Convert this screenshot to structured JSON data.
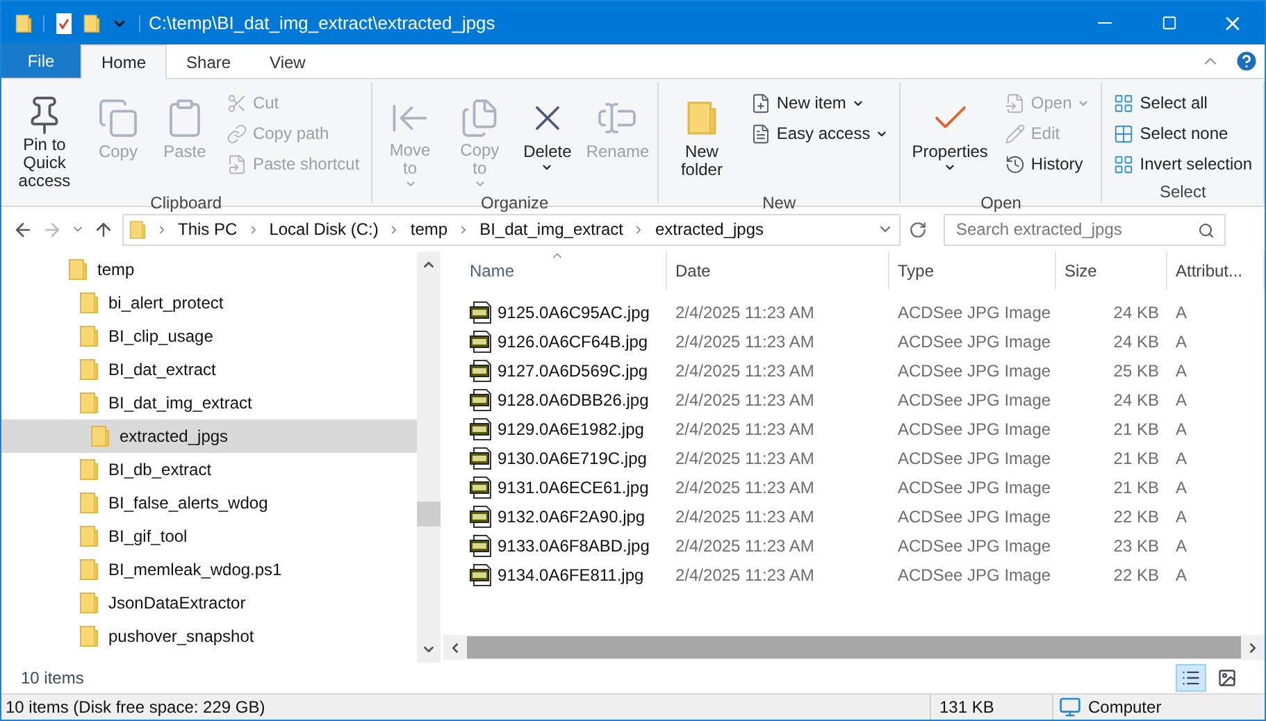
{
  "window": {
    "title": "C:\\temp\\BI_dat_img_extract\\extracted_jpgs"
  },
  "ribbon": {
    "tabs": [
      {
        "label": "File",
        "kind": "file",
        "selected": false
      },
      {
        "label": "Home",
        "kind": "tab",
        "selected": true
      },
      {
        "label": "Share",
        "kind": "tab",
        "selected": false
      },
      {
        "label": "View",
        "kind": "tab",
        "selected": false
      }
    ],
    "groups": [
      {
        "label": "Clipboard",
        "items": [
          {
            "label": "Pin to Quick access",
            "kind": "large",
            "disabled": false
          },
          {
            "label": "Copy",
            "kind": "large",
            "disabled": true
          },
          {
            "label": "Paste",
            "kind": "large",
            "disabled": true
          },
          {
            "kind": "stack",
            "items": [
              {
                "label": "Cut",
                "disabled": true
              },
              {
                "label": "Copy path",
                "disabled": true
              },
              {
                "label": "Paste shortcut",
                "disabled": true
              }
            ]
          }
        ]
      },
      {
        "label": "Organize",
        "items": [
          {
            "label": "Move to",
            "kind": "large",
            "disabled": true,
            "dropdown": true
          },
          {
            "label": "Copy to",
            "kind": "large",
            "disabled": true,
            "dropdown": true
          },
          {
            "label": "Delete",
            "kind": "large",
            "disabled": false,
            "dropdown": true
          },
          {
            "label": "Rename",
            "kind": "large",
            "disabled": true
          }
        ]
      },
      {
        "label": "New",
        "items": [
          {
            "label": "New folder",
            "kind": "large",
            "disabled": false
          },
          {
            "kind": "stack",
            "items": [
              {
                "label": "New item",
                "disabled": false,
                "dropdown": true
              },
              {
                "label": "Easy access",
                "disabled": false,
                "dropdown": true
              }
            ]
          }
        ]
      },
      {
        "label": "Open",
        "items": [
          {
            "label": "Properties",
            "kind": "large",
            "disabled": false,
            "dropdown": true
          },
          {
            "kind": "stack",
            "items": [
              {
                "label": "Open",
                "disabled": true,
                "dropdown": true
              },
              {
                "label": "Edit",
                "disabled": true
              },
              {
                "label": "History",
                "disabled": false
              }
            ]
          }
        ]
      },
      {
        "label": "Select",
        "items": [
          {
            "kind": "stack",
            "items": [
              {
                "label": "Select all",
                "disabled": false
              },
              {
                "label": "Select none",
                "disabled": false
              },
              {
                "label": "Invert selection",
                "disabled": false
              }
            ]
          }
        ]
      }
    ]
  },
  "address": {
    "crumbs": [
      "This PC",
      "Local Disk (C:)",
      "temp",
      "BI_dat_img_extract",
      "extracted_jpgs"
    ],
    "search_placeholder": "Search extracted_jpgs"
  },
  "nav_tree": [
    {
      "label": "temp",
      "selected": false,
      "children": [
        {
          "label": "bi_alert_protect",
          "selected": false
        },
        {
          "label": "BI_clip_usage",
          "selected": false
        },
        {
          "label": "BI_dat_extract",
          "selected": false
        },
        {
          "label": "BI_dat_img_extract",
          "selected": false,
          "children": [
            {
              "label": "extracted_jpgs",
              "selected": true
            }
          ]
        },
        {
          "label": "BI_db_extract",
          "selected": false
        },
        {
          "label": "BI_false_alerts_wdog",
          "selected": false
        },
        {
          "label": "BI_gif_tool",
          "selected": false
        },
        {
          "label": "BI_memleak_wdog.ps1",
          "selected": false
        },
        {
          "label": "JsonDataExtractor",
          "selected": false
        },
        {
          "label": "pushover_snapshot",
          "selected": false
        }
      ]
    }
  ],
  "file_list": {
    "columns": [
      {
        "label": "Name",
        "sorted": true
      },
      {
        "label": "Date",
        "sorted": false
      },
      {
        "label": "Type",
        "sorted": false
      },
      {
        "label": "Size",
        "sorted": false
      },
      {
        "label": "Attribut...",
        "sorted": false
      }
    ],
    "rows": [
      [
        "9125.0A6C95AC.jpg",
        "2/4/2025 11:23 AM",
        "ACDSee JPG Image",
        "24 KB",
        "A"
      ],
      [
        "9126.0A6CF64B.jpg",
        "2/4/2025 11:23 AM",
        "ACDSee JPG Image",
        "24 KB",
        "A"
      ],
      [
        "9127.0A6D569C.jpg",
        "2/4/2025 11:23 AM",
        "ACDSee JPG Image",
        "25 KB",
        "A"
      ],
      [
        "9128.0A6DBB26.jpg",
        "2/4/2025 11:23 AM",
        "ACDSee JPG Image",
        "24 KB",
        "A"
      ],
      [
        "9129.0A6E1982.jpg",
        "2/4/2025 11:23 AM",
        "ACDSee JPG Image",
        "21 KB",
        "A"
      ],
      [
        "9130.0A6E719C.jpg",
        "2/4/2025 11:23 AM",
        "ACDSee JPG Image",
        "21 KB",
        "A"
      ],
      [
        "9131.0A6ECE61.jpg",
        "2/4/2025 11:23 AM",
        "ACDSee JPG Image",
        "21 KB",
        "A"
      ],
      [
        "9132.0A6F2A90.jpg",
        "2/4/2025 11:23 AM",
        "ACDSee JPG Image",
        "22 KB",
        "A"
      ],
      [
        "9133.0A6F8ABD.jpg",
        "2/4/2025 11:23 AM",
        "ACDSee JPG Image",
        "23 KB",
        "A"
      ],
      [
        "9134.0A6FE811.jpg",
        "2/4/2025 11:23 AM",
        "ACDSee JPG Image",
        "22 KB",
        "A"
      ]
    ]
  },
  "view_buttons": [
    {
      "kind": "details",
      "selected": true
    },
    {
      "kind": "thumbnails",
      "selected": false
    }
  ],
  "pane_status": "10 items",
  "status_bar": {
    "summary": "10 items (Disk free space: 229 GB)",
    "size": "131 KB",
    "location": "Computer"
  }
}
